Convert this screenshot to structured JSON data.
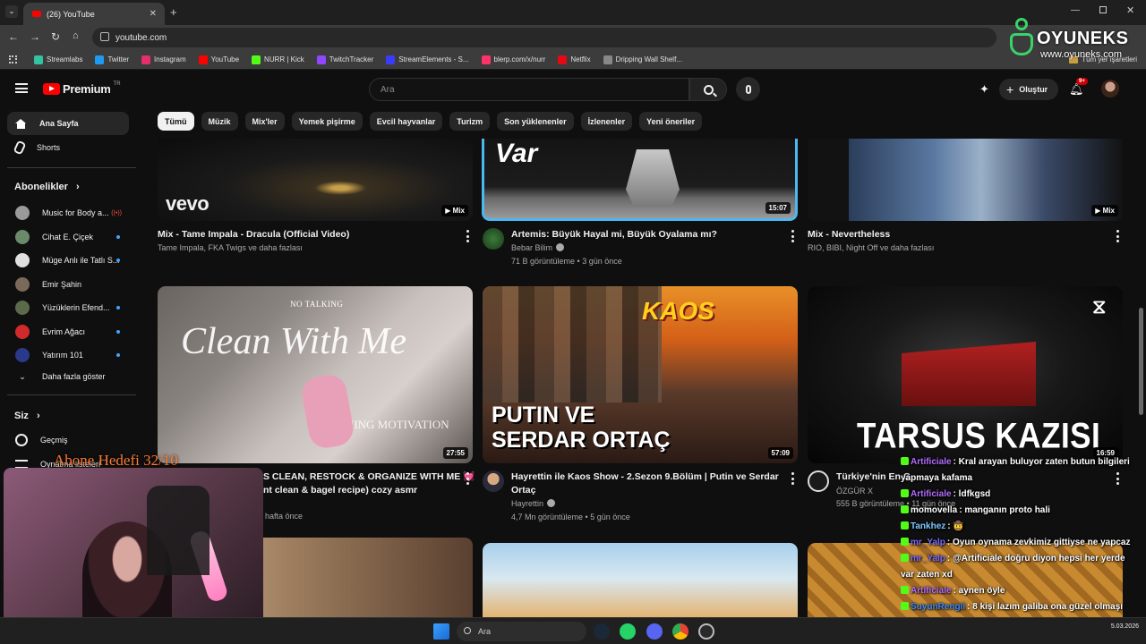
{
  "browser": {
    "tab_title": "(26) YouTube",
    "url": "youtube.com",
    "bookmarks": [
      {
        "label": "Streamlabs",
        "color": "#31c3a2"
      },
      {
        "label": "Twitter",
        "color": "#1d9bf0"
      },
      {
        "label": "Instagram",
        "color": "#e1306c"
      },
      {
        "label": "YouTube",
        "color": "#ff0000"
      },
      {
        "label": "NURR | Kick",
        "color": "#53fc18"
      },
      {
        "label": "TwitchTracker",
        "color": "#9146ff"
      },
      {
        "label": "StreamElements - S...",
        "color": "#3b3bff"
      },
      {
        "label": "blerp.com/x/nurr",
        "color": "#ff3366"
      },
      {
        "label": "Netflix",
        "color": "#e50914"
      },
      {
        "label": "Dripping Wall Shelf...",
        "color": "#888888"
      }
    ],
    "bookmarks_more": "Tüm yer işaretleri"
  },
  "header": {
    "logo_text": "Premium",
    "logo_sup": "TR",
    "search_placeholder": "Ara",
    "create_label": "Oluştur",
    "notif_badge": "9+"
  },
  "sidebar": {
    "items": [
      {
        "label": "Ana Sayfa",
        "icon": "home-icon"
      },
      {
        "label": "Shorts",
        "icon": "shorts-icon"
      }
    ],
    "subs_heading": "Abonelikler",
    "subs": [
      {
        "label": "Music for Body a...",
        "color": "#9a9a9a",
        "live": true
      },
      {
        "label": "Cihat E. Çiçek",
        "color": "#6a8a6a",
        "dot": true
      },
      {
        "label": "Müge Anlı ile Tatlı S...",
        "color": "#e0e0e0",
        "dot": true
      },
      {
        "label": "Emir Şahin",
        "color": "#7a6a5a",
        "dot": false
      },
      {
        "label": "Yüzüklerin Efend...",
        "color": "#5a6a4a",
        "dot": true
      },
      {
        "label": "Evrim Ağacı",
        "color": "#d02a2a",
        "dot": true
      },
      {
        "label": "Yatırım 101",
        "color": "#2a3a8a",
        "dot": true
      }
    ],
    "show_more": "Daha fazla göster",
    "you_heading": "Siz",
    "you_items": [
      {
        "label": "Geçmiş",
        "icon": "history-icon"
      },
      {
        "label": "Oynatma listeleri",
        "icon": "playlist-icon"
      }
    ]
  },
  "chips": [
    "Tümü",
    "Müzik",
    "Mix'ler",
    "Yemek pişirme",
    "Evcil hayvanlar",
    "Turizm",
    "Son yüklenenler",
    "İzlenenler",
    "Yeni öneriler"
  ],
  "videos_row1": [
    {
      "title": "Mix - Tame Impala - Dracula (Official Video)",
      "meta1": "Tame Impala, FKA Twigs ve daha fazlası",
      "meta2": "",
      "badge": "Mix",
      "overlay": "vevo"
    },
    {
      "title": "Artemis: Büyük Hayal mi, Büyük Oyalama mı?",
      "meta1": "Bebar Bilim",
      "meta2": "71 B görüntüleme • 3 gün önce",
      "badge": "15:07",
      "overlay": "Var"
    },
    {
      "title": "Mix - Nevertheless",
      "meta1": "RIO, BIBI, Night Off ve daha fazlası",
      "meta2": "",
      "badge": "Mix",
      "overlay": ""
    }
  ],
  "videos_row2": [
    {
      "title_l1": "S CLEAN, RESTOCK & ORGANIZE WITH ME 💓",
      "title_l2": "nt clean & bagel recipe) cozy asmr",
      "meta": "hafta önce",
      "duration": "27:55",
      "overlay_1": "Clean With Me",
      "overlay_2": "NO TALKING",
      "overlay_3": "CLEANING MOTIVATION"
    },
    {
      "title_l1": "Hayrettin ile Kaos Show - 2.Sezon 9.Bölüm | Putin ve Serdar",
      "title_l2": "Ortaç",
      "channel": "Hayrettin",
      "meta": "4,7 Mn görüntüleme • 5 gün önce",
      "duration": "57:09",
      "overlay_1": "PUTIN VE",
      "overlay_2": "SERDAR ORTAÇ",
      "overlay_3": "KAOS"
    },
    {
      "title_l1": "Türkiye'nin En G",
      "channel": "ÖZGÜR X",
      "meta": "555 B görüntüleme • 11 gün önce",
      "duration": "16:59",
      "overlay_1": "TARSUS KAZISI"
    }
  ],
  "overlay": {
    "goal": "Abone Hedefi 32/10",
    "watermark_name": "OYUNEKS",
    "watermark_url": "www.oyuneks.com",
    "chat": [
      {
        "user": "Artificiale",
        "color": "#b36cff",
        "text": ": Kral arayan buluyor zaten butun bilgileri yapmaya kafama"
      },
      {
        "user": "Artificiale",
        "color": "#b36cff",
        "text": ": ldfkgsd"
      },
      {
        "user": "momovella",
        "color": "#ffffff",
        "text": ": manganın proto hali"
      },
      {
        "user": "Tankhez",
        "color": "#7ec8ff",
        "text": ": 🤠"
      },
      {
        "user": "mr_Yalp",
        "color": "#7a6cff",
        "text": ": Oyun oynama zevkimiz gittiyse ne yapcaz"
      },
      {
        "user": "mr_Yalp",
        "color": "#7a6cff",
        "text": ": @Artificiale doğru diyon hepsi her yerde var zaten xd"
      },
      {
        "user": "Artificiale",
        "color": "#b36cff",
        "text": ": aynen öyle"
      },
      {
        "user": "SuyunRengii",
        "color": "#3a8aff",
        "text": ": 8 kişi lazım galiba ona güzel olmaşı için"
      }
    ]
  },
  "taskbar": {
    "search": "Ara",
    "time": "5.03.2026"
  }
}
